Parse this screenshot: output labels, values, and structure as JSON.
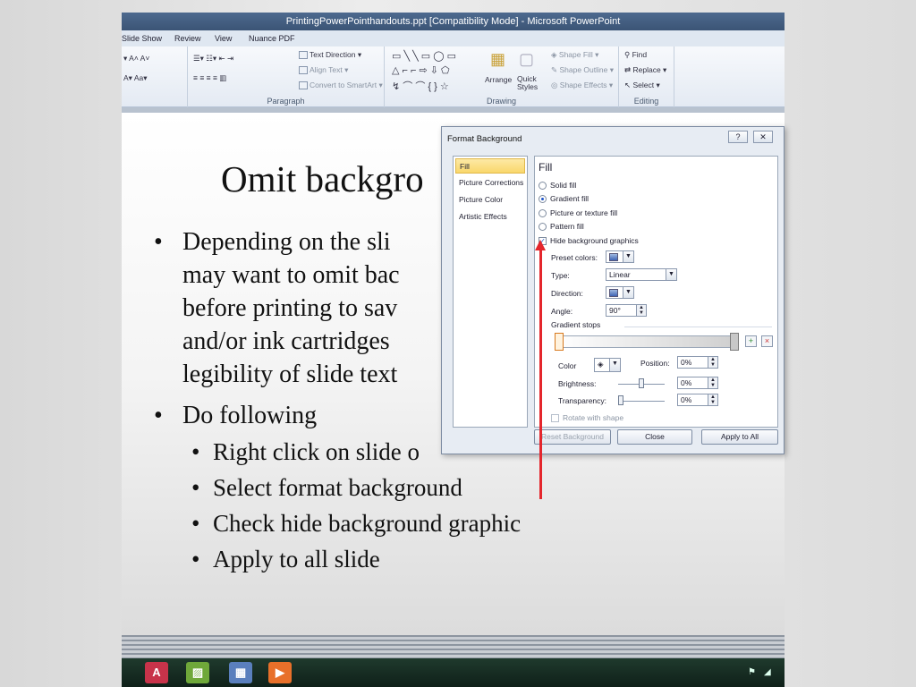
{
  "window": {
    "title": "PrintingPowerPointhandouts.ppt [Compatibility Mode] - Microsoft PowerPoint"
  },
  "ribbon_tabs": [
    "Slide Show",
    "Review",
    "View",
    "Nuance PDF"
  ],
  "ribbon": {
    "paragraph": {
      "label": "Paragraph",
      "text_direction": "Text Direction",
      "align_text": "Align Text",
      "convert_smartart": "Convert to SmartArt"
    },
    "drawing": {
      "label": "Drawing",
      "arrange": "Arrange",
      "quick_styles": "Quick Styles",
      "shape_fill": "Shape Fill",
      "shape_outline": "Shape Outline",
      "shape_effects": "Shape Effects"
    },
    "editing": {
      "label": "Editing",
      "find": "Find",
      "replace": "Replace",
      "select": "Select"
    }
  },
  "slide": {
    "title": "Omit backgro",
    "bullets": [
      {
        "lines": [
          "Depending on the sli",
          "may want to omit bac",
          "before printing to sav",
          "and/or ink cartridges",
          "legibility of slide text"
        ]
      },
      {
        "lines": [
          "Do following"
        ]
      }
    ],
    "sub_bullets": [
      "Right click on slide o",
      "Select format background",
      "Check hide background graphic",
      "Apply to all slide"
    ]
  },
  "dialog": {
    "title": "Format Background",
    "help": "?",
    "close": "✕",
    "nav": [
      "Fill",
      "Picture Corrections",
      "Picture Color",
      "Artistic Effects"
    ],
    "fill_header": "Fill",
    "options": [
      "Solid fill",
      "Gradient fill",
      "Picture or texture fill",
      "Pattern fill"
    ],
    "selected_option": "Gradient fill",
    "hide_bg": "Hide background graphics",
    "hide_bg_checked": true,
    "preset_colors_label": "Preset colors:",
    "type_label": "Type:",
    "type_value": "Linear",
    "direction_label": "Direction:",
    "angle_label": "Angle:",
    "angle_value": "90°",
    "gradient_stops_label": "Gradient stops",
    "color_label": "Color",
    "position_label": "Position:",
    "position_value": "0%",
    "brightness_label": "Brightness:",
    "brightness_value": "0%",
    "transparency_label": "Transparency:",
    "transparency_value": "0%",
    "rotate_label": "Rotate with shape",
    "buttons": {
      "reset": "Reset Background",
      "close": "Close",
      "apply_all": "Apply to All"
    }
  },
  "colors": {
    "accent_arrow": "#e4262c",
    "nav_selected": "#f9d76b",
    "title_bar": "#3b5475"
  }
}
